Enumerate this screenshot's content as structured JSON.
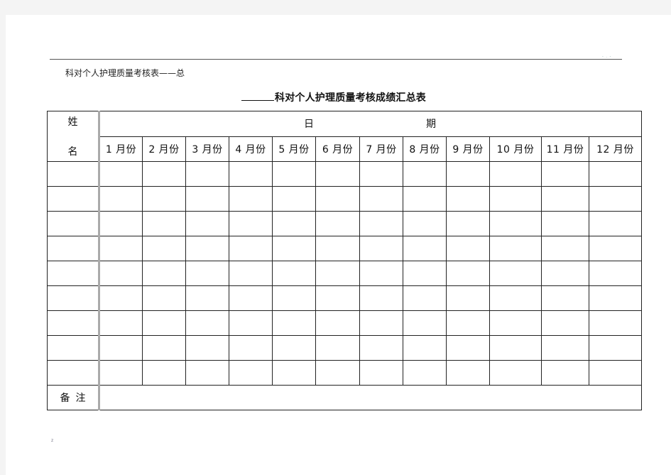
{
  "running_head": "科对个人护理质量考核表——总",
  "header_mark": "- . -",
  "title": {
    "blank": "",
    "text": "科对个人护理质量考核成绩汇总表"
  },
  "table": {
    "name_header_top": "姓",
    "name_header_bottom": "名",
    "date_header_left": "日",
    "date_header_right": "期",
    "months": [
      "1 月份",
      "2 月份",
      "3 月份",
      "4 月份",
      "5 月份",
      "6 月份",
      "7 月份",
      "8 月份",
      "9 月份",
      "10 月份",
      "11 月份",
      "12 月份"
    ],
    "rows": [
      {
        "name": "",
        "values": [
          "",
          "",
          "",
          "",
          "",
          "",
          "",
          "",
          "",
          "",
          "",
          ""
        ]
      },
      {
        "name": "",
        "values": [
          "",
          "",
          "",
          "",
          "",
          "",
          "",
          "",
          "",
          "",
          "",
          ""
        ]
      },
      {
        "name": "",
        "values": [
          "",
          "",
          "",
          "",
          "",
          "",
          "",
          "",
          "",
          "",
          "",
          ""
        ]
      },
      {
        "name": "",
        "values": [
          "",
          "",
          "",
          "",
          "",
          "",
          "",
          "",
          "",
          "",
          "",
          ""
        ]
      },
      {
        "name": "",
        "values": [
          "",
          "",
          "",
          "",
          "",
          "",
          "",
          "",
          "",
          "",
          "",
          ""
        ]
      },
      {
        "name": "",
        "values": [
          "",
          "",
          "",
          "",
          "",
          "",
          "",
          "",
          "",
          "",
          "",
          ""
        ]
      },
      {
        "name": "",
        "values": [
          "",
          "",
          "",
          "",
          "",
          "",
          "",
          "",
          "",
          "",
          "",
          ""
        ]
      },
      {
        "name": "",
        "values": [
          "",
          "",
          "",
          "",
          "",
          "",
          "",
          "",
          "",
          "",
          "",
          ""
        ]
      },
      {
        "name": "",
        "values": [
          "",
          "",
          "",
          "",
          "",
          "",
          "",
          "",
          "",
          "",
          "",
          ""
        ]
      }
    ],
    "note_label": "备注",
    "note_value": ""
  },
  "footer_mark": "z"
}
